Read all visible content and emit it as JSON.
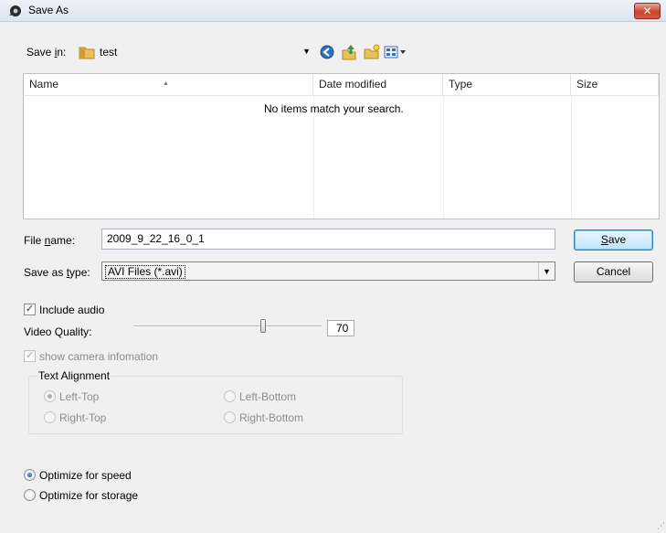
{
  "window": {
    "title": "Save As",
    "close_glyph": "✕"
  },
  "save_in": {
    "label_pre": "Save ",
    "label_ul": "i",
    "label_post": "n:",
    "value": "test"
  },
  "toolbar": {
    "icons": [
      "back-icon",
      "up-folder-icon",
      "new-folder-icon",
      "views-menu-icon"
    ]
  },
  "list": {
    "columns": [
      "Name",
      "Date modified",
      "Type",
      "Size"
    ],
    "empty_message": "No items match your search."
  },
  "file_name": {
    "label_pre": "File ",
    "label_ul": "n",
    "label_post": "ame:",
    "value": "2009_9_22_16_0_1"
  },
  "save_as_type": {
    "label_pre": "Save as ",
    "label_ul": "t",
    "label_post": "ype:",
    "value": "AVI Files (*.avi)"
  },
  "buttons": {
    "save_ul": "S",
    "save_rest": "ave",
    "cancel": "Cancel"
  },
  "options": {
    "include_audio": {
      "label": "Include audio",
      "checked": true
    },
    "video_quality": {
      "label": "Video Quality:",
      "value": "70",
      "level": 70
    },
    "show_camera": {
      "label": "show camera infomation",
      "checked": true,
      "disabled": true
    },
    "text_alignment": {
      "title": "Text Alignment",
      "options": [
        "Left-Top",
        "Left-Bottom",
        "Right-Top",
        "Right-Bottom"
      ],
      "selected": "Left-Top"
    },
    "optimize": {
      "options": [
        "Optimize for speed",
        "Optimize for storage"
      ],
      "selected": "Optimize for speed"
    }
  },
  "colors": {
    "titlebar": "#dae5f2",
    "close_button": "#c6452b",
    "dialog_bg": "#f0f0f0"
  }
}
